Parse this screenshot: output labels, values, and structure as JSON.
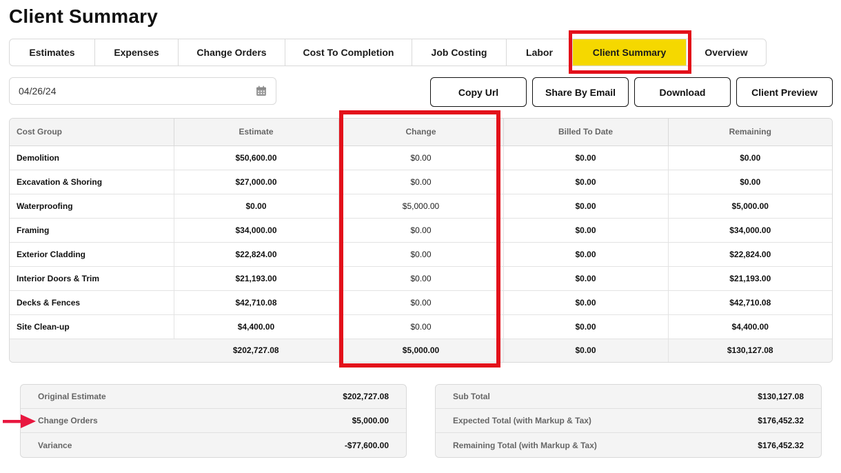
{
  "page": {
    "title": "Client Summary"
  },
  "tabs": [
    {
      "label": "Estimates",
      "active": false
    },
    {
      "label": "Expenses",
      "active": false
    },
    {
      "label": "Change Orders",
      "active": false
    },
    {
      "label": "Cost To Completion",
      "active": false
    },
    {
      "label": "Job Costing",
      "active": false
    },
    {
      "label": "Labor",
      "active": false
    },
    {
      "label": "Client Summary",
      "active": true
    },
    {
      "label": "Overview",
      "active": false
    }
  ],
  "date_input": {
    "value": "04/26/24",
    "icon": "calendar-icon"
  },
  "actions": {
    "copy_url": "Copy Url",
    "share_email": "Share By Email",
    "download": "Download",
    "client_preview": "Client Preview"
  },
  "table": {
    "headers": [
      "Cost Group",
      "Estimate",
      "Change",
      "Billed To Date",
      "Remaining"
    ],
    "rows": [
      {
        "group": "Demolition",
        "estimate": "$50,600.00",
        "change": "$0.00",
        "billed": "$0.00",
        "remaining": "$0.00"
      },
      {
        "group": "Excavation & Shoring",
        "estimate": "$27,000.00",
        "change": "$0.00",
        "billed": "$0.00",
        "remaining": "$0.00"
      },
      {
        "group": "Waterproofing",
        "estimate": "$0.00",
        "change": "$5,000.00",
        "billed": "$0.00",
        "remaining": "$5,000.00"
      },
      {
        "group": "Framing",
        "estimate": "$34,000.00",
        "change": "$0.00",
        "billed": "$0.00",
        "remaining": "$34,000.00"
      },
      {
        "group": "Exterior Cladding",
        "estimate": "$22,824.00",
        "change": "$0.00",
        "billed": "$0.00",
        "remaining": "$22,824.00"
      },
      {
        "group": "Interior Doors & Trim",
        "estimate": "$21,193.00",
        "change": "$0.00",
        "billed": "$0.00",
        "remaining": "$21,193.00"
      },
      {
        "group": "Decks & Fences",
        "estimate": "$42,710.08",
        "change": "$0.00",
        "billed": "$0.00",
        "remaining": "$42,710.08"
      },
      {
        "group": "Site Clean-up",
        "estimate": "$4,400.00",
        "change": "$0.00",
        "billed": "$0.00",
        "remaining": "$4,400.00"
      }
    ],
    "totals": {
      "estimate": "$202,727.08",
      "change": "$5,000.00",
      "billed": "$0.00",
      "remaining": "$130,127.08"
    }
  },
  "summary_left": [
    {
      "label": "Original Estimate",
      "value": "$202,727.08"
    },
    {
      "label": "Change Orders",
      "value": "$5,000.00"
    },
    {
      "label": "Variance",
      "value": "-$77,600.00"
    }
  ],
  "summary_right": [
    {
      "label": "Sub Total",
      "value": "$130,127.08"
    },
    {
      "label": "Expected Total (with Markup & Tax)",
      "value": "$176,452.32"
    },
    {
      "label": "Remaining Total (with Markup & Tax)",
      "value": "$176,452.32"
    }
  ],
  "colors": {
    "accent_active_tab": "#f5d800",
    "highlight_red": "#e3101a",
    "arrow_red": "#e8173f"
  }
}
